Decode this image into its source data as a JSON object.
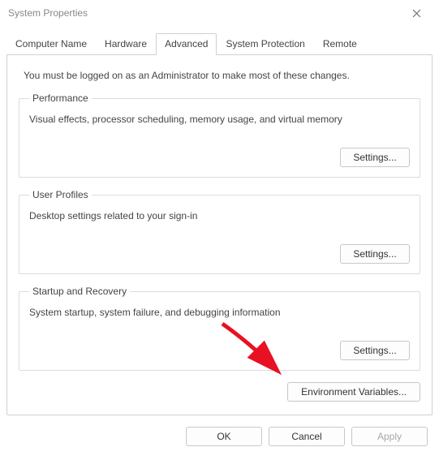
{
  "window": {
    "title": "System Properties"
  },
  "tabs": {
    "computer_name": "Computer Name",
    "hardware": "Hardware",
    "advanced": "Advanced",
    "system_protection": "System Protection",
    "remote": "Remote"
  },
  "intro": "You must be logged on as an Administrator to make most of these changes.",
  "groups": {
    "performance": {
      "legend": "Performance",
      "desc": "Visual effects, processor scheduling, memory usage, and virtual memory",
      "button": "Settings..."
    },
    "user_profiles": {
      "legend": "User Profiles",
      "desc": "Desktop settings related to your sign-in",
      "button": "Settings..."
    },
    "startup": {
      "legend": "Startup and Recovery",
      "desc": "System startup, system failure, and debugging information",
      "button": "Settings..."
    }
  },
  "env_button": "Environment Variables...",
  "dialog": {
    "ok": "OK",
    "cancel": "Cancel",
    "apply": "Apply"
  }
}
